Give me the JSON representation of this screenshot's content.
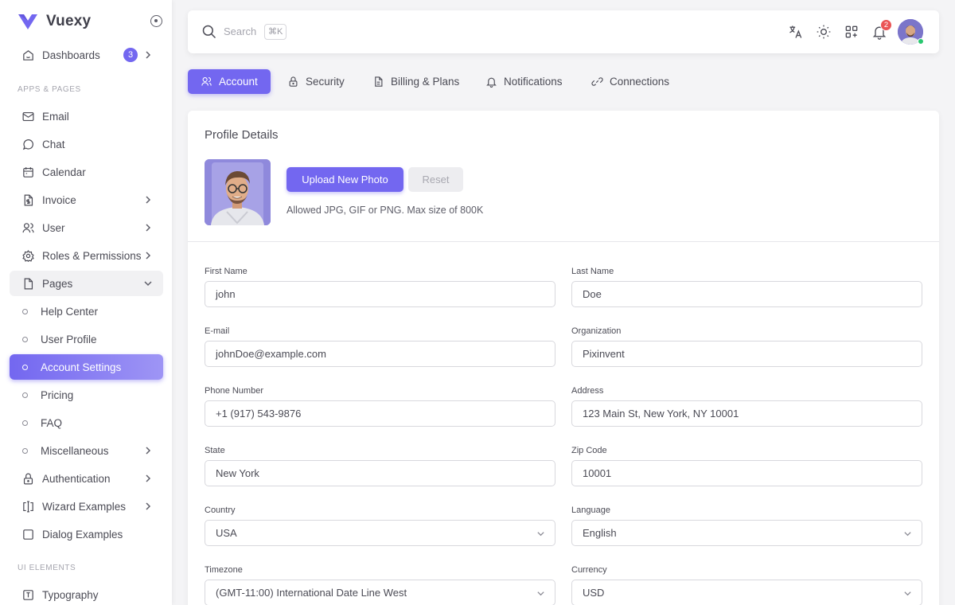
{
  "brand": {
    "name": "Vuexy",
    "color": "#7367f0"
  },
  "sidebar": {
    "dashboards": {
      "label": "Dashboards",
      "badge": "3"
    },
    "section_apps": "APPS & PAGES",
    "items": [
      {
        "label": "Email",
        "icon": "mail-icon"
      },
      {
        "label": "Chat",
        "icon": "chat-icon"
      },
      {
        "label": "Calendar",
        "icon": "calendar-icon"
      },
      {
        "label": "Invoice",
        "icon": "invoice-icon"
      },
      {
        "label": "User",
        "icon": "users-icon"
      },
      {
        "label": "Roles & Permissions",
        "icon": "settings-icon"
      },
      {
        "label": "Pages",
        "icon": "file-icon"
      }
    ],
    "sub_items": [
      {
        "label": "Help Center"
      },
      {
        "label": "User Profile"
      },
      {
        "label": "Account Settings"
      },
      {
        "label": "Pricing"
      },
      {
        "label": "FAQ"
      },
      {
        "label": "Miscellaneous"
      }
    ],
    "more_items": [
      {
        "label": "Authentication",
        "icon": "lock-icon"
      },
      {
        "label": "Wizard Examples",
        "icon": "wizard-icon"
      },
      {
        "label": "Dialog Examples",
        "icon": "square-icon"
      }
    ],
    "section_ui": "UI ELEMENTS",
    "typography": {
      "label": "Typography",
      "icon": "typography-icon"
    }
  },
  "topbar": {
    "search_placeholder": "Search",
    "shortcut": "⌘K",
    "notification_count": "2"
  },
  "tabs": [
    {
      "label": "Account",
      "icon": "users-icon"
    },
    {
      "label": "Security",
      "icon": "lock-icon"
    },
    {
      "label": "Billing & Plans",
      "icon": "file-icon"
    },
    {
      "label": "Notifications",
      "icon": "bell-icon"
    },
    {
      "label": "Connections",
      "icon": "link-icon"
    }
  ],
  "profile": {
    "title": "Profile Details",
    "upload_label": "Upload New Photo",
    "reset_label": "Reset",
    "hint": "Allowed JPG, GIF or PNG. Max size of 800K"
  },
  "form": {
    "first_name": {
      "label": "First Name",
      "value": "john"
    },
    "last_name": {
      "label": "Last Name",
      "value": "Doe"
    },
    "email": {
      "label": "E-mail",
      "value": "johnDoe@example.com"
    },
    "organization": {
      "label": "Organization",
      "value": "Pixinvent"
    },
    "phone": {
      "label": "Phone Number",
      "value": "+1 (917) 543-9876"
    },
    "address": {
      "label": "Address",
      "value": "123 Main St, New York, NY 10001"
    },
    "state": {
      "label": "State",
      "value": "New York"
    },
    "zip": {
      "label": "Zip Code",
      "value": "10001"
    },
    "country": {
      "label": "Country",
      "value": "USA"
    },
    "language": {
      "label": "Language",
      "value": "English"
    },
    "timezone": {
      "label": "Timezone",
      "value": "(GMT-11:00) International Date Line West"
    },
    "currency": {
      "label": "Currency",
      "value": "USD"
    }
  }
}
